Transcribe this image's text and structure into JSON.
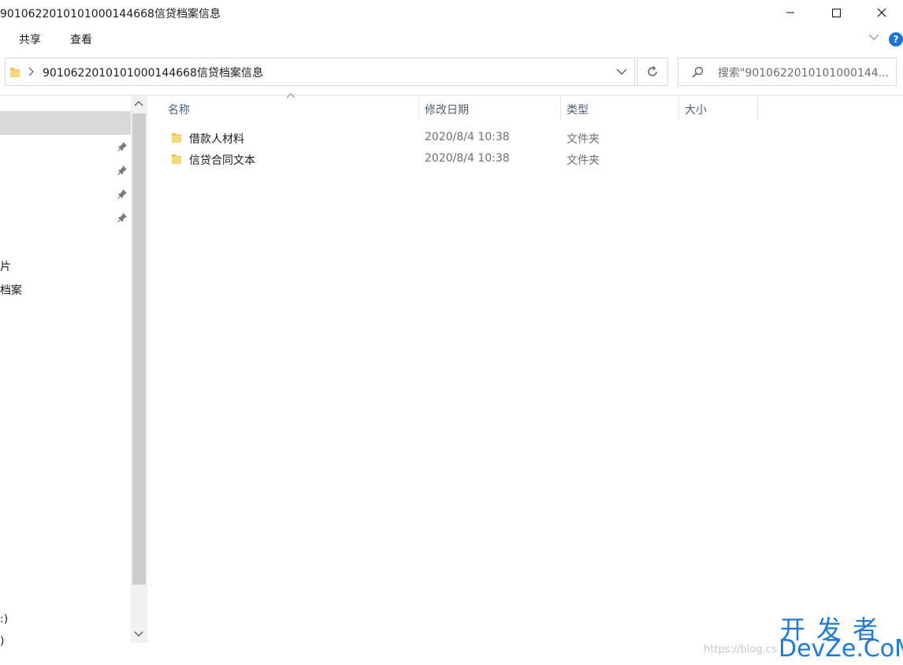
{
  "window": {
    "title": "9010622010101000144668信贷档案信息"
  },
  "ribbon": {
    "tabs": [
      "共享",
      "查看"
    ],
    "help_label": "?"
  },
  "address": {
    "path": "9010622010101000144668信贷档案信息",
    "search_placeholder": "搜索\"9010622010101000144..."
  },
  "nav": {
    "items": [
      "片",
      "档案",
      ":)",
      ")"
    ]
  },
  "columns": {
    "name": "名称",
    "modified": "修改日期",
    "type": "类型",
    "size": "大小"
  },
  "files": [
    {
      "name": "借款人材料",
      "modified": "2020/8/4 10:38",
      "type": "文件夹"
    },
    {
      "name": "信贷合同文本",
      "modified": "2020/8/4 10:38",
      "type": "文件夹"
    }
  ],
  "watermark": {
    "url": "https://blog.cs",
    "brand_top": "开发者",
    "brand_bottom": "DevZe.CoM"
  },
  "colors": {
    "accent": "#1a73d6",
    "folder": "#f2c14e",
    "header_text": "#4c607a"
  }
}
